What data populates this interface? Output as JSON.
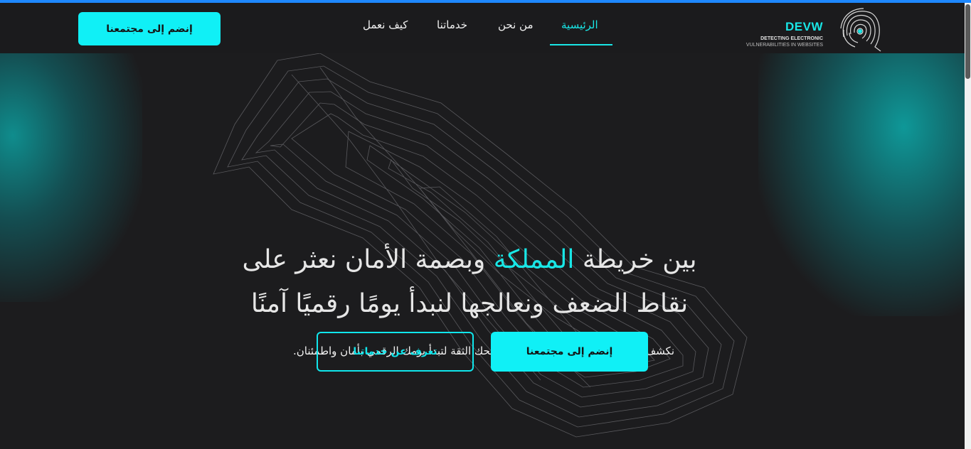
{
  "logo": {
    "title": "DEVW",
    "subtitle_line1": "DETECTING ELECTRONIC",
    "subtitle_line2": "VULNERABILITIES IN WEBSITES"
  },
  "nav": {
    "items": [
      {
        "label": "الرئيسية",
        "active": true
      },
      {
        "label": "من نحن",
        "active": false
      },
      {
        "label": "خدماتنا",
        "active": false
      },
      {
        "label": "كيف نعمل",
        "active": false
      }
    ],
    "join_button": "إنضم إلى مجتمعنا"
  },
  "hero": {
    "headline_before": "بين خريطة ",
    "headline_accent": "المملكة",
    "headline_after": " وبصمة الأمان نعثر على",
    "headline_line2": "نقاط الضعف ونعالجها لنبدأ يومًا رقميًا آمنًا",
    "subtitle": "نكشف نقاط الضعف، نعالجها بسرعة، ونمنحك الثقة لتبدأ يومك الرقمي بأمان واطمئنان.",
    "primary_button": "إنضم إلى مجتمعنا",
    "secondary_button": "تعرف عن خدماتنا"
  },
  "colors": {
    "accent": "#19e6e6",
    "button": "#10f0f6",
    "background": "#1c1c1e",
    "top_line": "#1e88ff"
  }
}
